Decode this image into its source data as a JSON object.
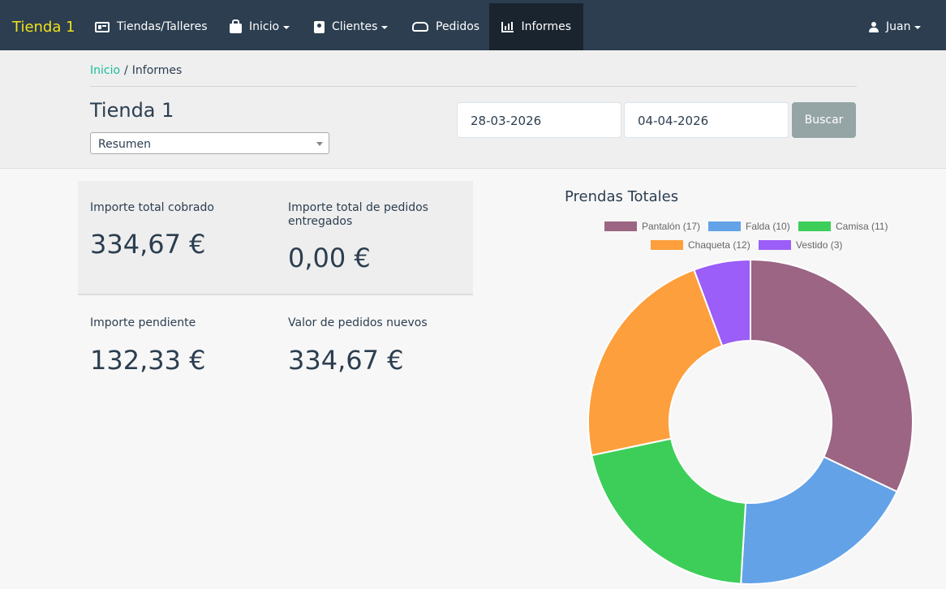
{
  "navbar": {
    "brand": "Tienda 1",
    "items": [
      {
        "label": "Tiendas/Talleres",
        "icon": "id-card-icon",
        "dropdown": false
      },
      {
        "label": "Inicio",
        "icon": "shopping-bag-icon",
        "dropdown": true
      },
      {
        "label": "Clientes",
        "icon": "address-book-icon",
        "dropdown": true
      },
      {
        "label": "Pedidos",
        "icon": "handshake-icon",
        "dropdown": false
      },
      {
        "label": "Informes",
        "icon": "bar-chart-icon",
        "dropdown": false,
        "active": true
      }
    ],
    "user": {
      "label": "Juan",
      "icon": "user-icon"
    }
  },
  "breadcrumb": {
    "home": "Inicio",
    "current": "Informes"
  },
  "store_title": "Tienda 1",
  "report_select": {
    "value": "Resumen"
  },
  "filters": {
    "date_from": "28-03-2026",
    "date_to": "04-04-2026",
    "search_label": "Buscar"
  },
  "stats": [
    {
      "label": "Importe total cobrado",
      "value": "334,67 €"
    },
    {
      "label": "Importe total de pedidos entregados",
      "value": "0,00 €"
    },
    {
      "label": "Importe pendiente",
      "value": "132,33 €"
    },
    {
      "label": "Valor de pedidos nuevos",
      "value": "334,67 €"
    }
  ],
  "chart_data": {
    "type": "pie",
    "title": "Prendas Totales",
    "categories": [
      "Pantalón",
      "Falda",
      "Camisa",
      "Chaqueta",
      "Vestido"
    ],
    "values": [
      17,
      10,
      11,
      12,
      3
    ],
    "legend_labels": [
      "Pantalón (17)",
      "Falda (10)",
      "Camisa (11)",
      "Chaqueta (12)",
      "Vestido (3)"
    ],
    "colors": [
      "#9b6583",
      "#63a2e7",
      "#3dce59",
      "#fd9f3d",
      "#9b5ef8"
    ],
    "legend_position": "top"
  },
  "colors": {
    "navbar": "#2c3e50",
    "brand": "#f1e21c",
    "link": "#18bc9c",
    "button": "#95a5a6"
  }
}
